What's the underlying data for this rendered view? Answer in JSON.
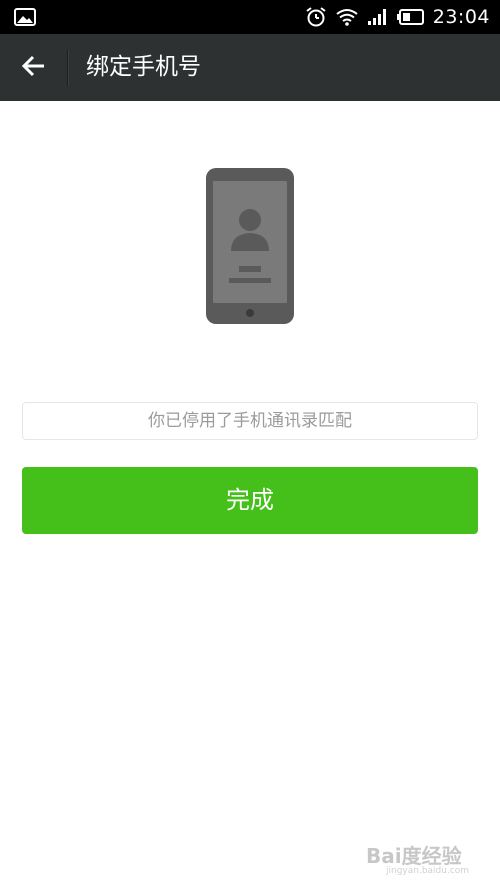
{
  "status_bar": {
    "time": "23:04",
    "icons": [
      "image-icon",
      "alarm-icon",
      "wifi-icon",
      "signal-icon",
      "battery-icon"
    ]
  },
  "title_bar": {
    "back_icon": "back-arrow-icon",
    "title": "绑定手机号"
  },
  "main": {
    "illustration_icon": "phone-contact-icon",
    "notice_text": "你已停用了手机通讯录匹配",
    "done_button_label": "完成"
  },
  "watermark": {
    "brand": "Bai度经验",
    "url": "jingyan.baidu.com"
  },
  "colors": {
    "status_bar_bg": "#000000",
    "title_bar_bg": "#2e3132",
    "accent_green": "#45c01a",
    "page_bg": "#ffffff",
    "illustration_gray": "#5a5a5a"
  }
}
